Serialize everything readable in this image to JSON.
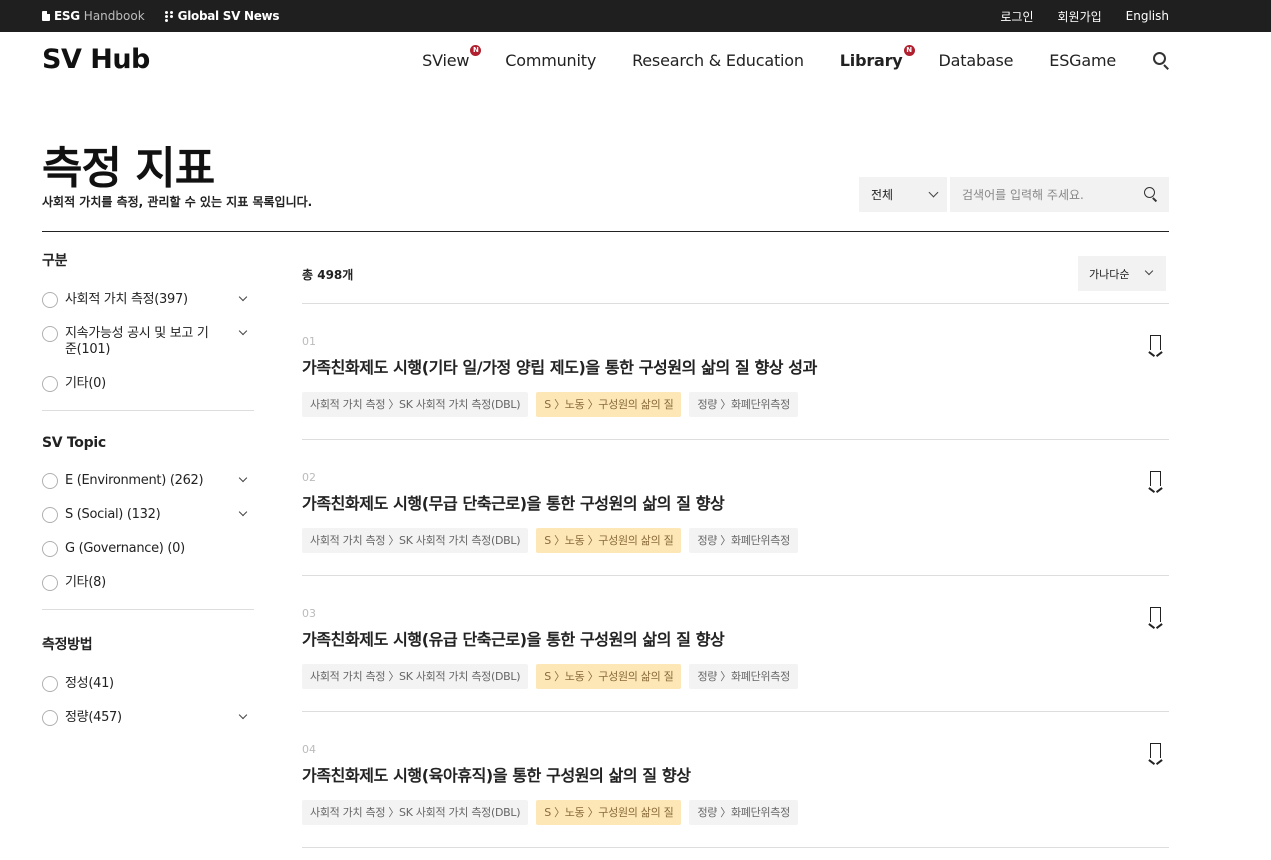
{
  "topbar": {
    "esg_bold": "ESG",
    "esg_light": "Handbook",
    "global_sv_news": "Global SV News",
    "login": "로그인",
    "signup": "회원가입",
    "language": "English"
  },
  "header": {
    "logo": "SV Hub",
    "nav": [
      {
        "label": "SView",
        "badge": "N"
      },
      {
        "label": "Community"
      },
      {
        "label": "Research & Education"
      },
      {
        "label": "Library",
        "badge": "N",
        "active": true
      },
      {
        "label": "Database"
      },
      {
        "label": "ESGame"
      }
    ]
  },
  "page": {
    "title": "측정 지표",
    "description": "사회적 가치를 측정, 관리할 수 있는 지표 목록입니다."
  },
  "search": {
    "scope_selected": "전체",
    "placeholder": "검색어를 입력해 주세요."
  },
  "sidebar": {
    "groups": [
      {
        "title": "구분",
        "options": [
          {
            "label": "사회적 가치 측정(397)",
            "expandable": true
          },
          {
            "label": "지속가능성 공시 및 보고 기준(101)",
            "expandable": true
          },
          {
            "label": "기타(0)",
            "expandable": false
          }
        ]
      },
      {
        "title": "SV Topic",
        "options": [
          {
            "label": "E (Environment) (262)",
            "expandable": true
          },
          {
            "label": "S (Social) (132)",
            "expandable": true
          },
          {
            "label": "G (Governance) (0)",
            "expandable": false
          },
          {
            "label": "기타(8)",
            "expandable": false
          }
        ]
      },
      {
        "title": "측정방법",
        "options": [
          {
            "label": "정성(41)",
            "expandable": false
          },
          {
            "label": "정량(457)",
            "expandable": true
          }
        ]
      }
    ]
  },
  "list": {
    "count": "총 498개",
    "sort_selected": "가나다순",
    "items": [
      {
        "num": "01",
        "title": "가족친화제도 시행(기타 일/가정 양립 제도)을 통한 구성원의 삶의 질 향상 성과",
        "tags": [
          "사회적 가치 측정 〉SK 사회적 가치 측정(DBL)",
          "S 〉노동 〉구성원의 삶의 질",
          "정량 〉화폐단위측정"
        ]
      },
      {
        "num": "02",
        "title": "가족친화제도 시행(무급 단축근로)을 통한 구성원의 삶의 질 향상",
        "tags": [
          "사회적 가치 측정 〉SK 사회적 가치 측정(DBL)",
          "S 〉노동 〉구성원의 삶의 질",
          "정량 〉화폐단위측정"
        ]
      },
      {
        "num": "03",
        "title": "가족친화제도 시행(유급 단축근로)을 통한 구성원의 삶의 질 향상",
        "tags": [
          "사회적 가치 측정 〉SK 사회적 가치 측정(DBL)",
          "S 〉노동 〉구성원의 삶의 질",
          "정량 〉화폐단위측정"
        ]
      },
      {
        "num": "04",
        "title": "가족친화제도 시행(육아휴직)을 통한 구성원의 삶의 질 향상",
        "tags": [
          "사회적 가치 측정 〉SK 사회적 가치 측정(DBL)",
          "S 〉노동 〉구성원의 삶의 질",
          "정량 〉화폐단위측정"
        ]
      }
    ]
  }
}
